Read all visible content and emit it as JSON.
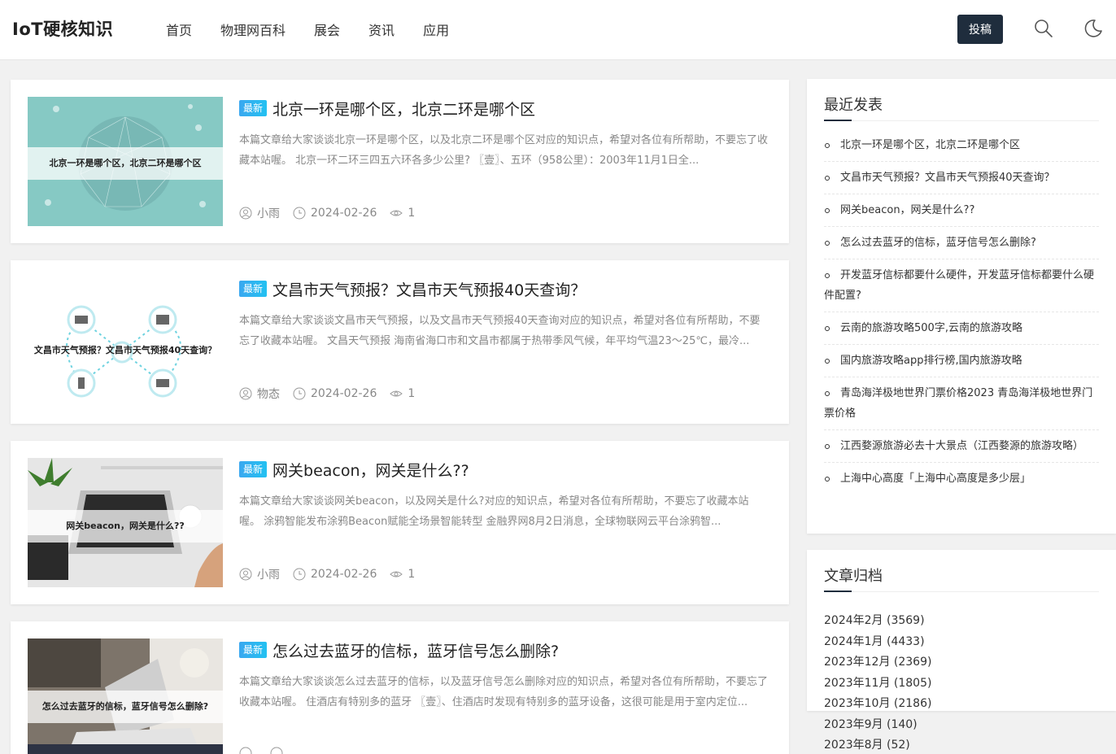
{
  "header": {
    "logo": "IoT硬核知识",
    "nav": [
      "首页",
      "物理网百科",
      "展会",
      "资讯",
      "应用"
    ],
    "post_button": "投稿",
    "icons": [
      "search-icon",
      "moon-icon"
    ]
  },
  "articles": [
    {
      "badge": "最新",
      "title": "北京一环是哪个区，北京二环是哪个区",
      "thumb_caption": "北京一环是哪个区，北京二环是哪个区",
      "excerpt": "本篇文章给大家谈谈北京一环是哪个区，以及北京二环是哪个区对应的知识点，希望对各位有所帮助，不要忘了收藏本站喔。 北京一环二环三四五六环各多少公里? 〖壹〗、五环（958公里）：2003年11月1日全...",
      "author": "小雨",
      "date": "2024-02-26",
      "views": "1"
    },
    {
      "badge": "最新",
      "title": "文昌市天气预报？文昌市天气预报40天查询？",
      "thumb_caption": "文昌市天气预报？文昌市天气预报40天查询？",
      "excerpt": "本篇文章给大家谈谈文昌市天气预报，以及文昌市天气预报40天查询对应的知识点，希望对各位有所帮助，不要忘了收藏本站喔。 文昌天气预报 海南省海口市和文昌市都属于热带季风气候，年平均气温23～25℃，最冷...",
      "author": "物态",
      "date": "2024-02-26",
      "views": "1"
    },
    {
      "badge": "最新",
      "title": "网关beacon，网关是什么??",
      "thumb_caption": "网关beacon，网关是什么??",
      "excerpt": "本篇文章给大家谈谈网关beacon，以及网关是什么?对应的知识点，希望对各位有所帮助，不要忘了收藏本站喔。 涂鸦智能发布涂鸦Beacon赋能全场景智能转型 金融界网8月2日消息，全球物联网云平台涂鸦智...",
      "author": "小雨",
      "date": "2024-02-26",
      "views": "1"
    },
    {
      "badge": "最新",
      "title": "怎么过去蓝牙的信标，蓝牙信号怎么删除?",
      "thumb_caption": "怎么过去蓝牙的信标，蓝牙信号怎么删除?",
      "excerpt": "本篇文章给大家谈谈怎么过去蓝牙的信标，以及蓝牙信号怎么删除对应的知识点，希望对各位有所帮助，不要忘了收藏本站喔。 住酒店有特别多的蓝牙 〖壹〗、住酒店时发现有特别多的蓝牙设备，这很可能是用于室内定位...",
      "author": "",
      "date": "",
      "views": ""
    }
  ],
  "sidebar": {
    "recent": {
      "title": "最近发表",
      "items": [
        "北京一环是哪个区，北京二环是哪个区",
        "文昌市天气预报？文昌市天气预报40天查询？",
        "网关beacon，网关是什么??",
        "怎么过去蓝牙的信标，蓝牙信号怎么删除?",
        "开发蓝牙信标都要什么硬件，开发蓝牙信标都要什么硬件配置?",
        "云南的旅游攻略500字,云南的旅游攻略",
        "国内旅游攻略app排行榜,国内旅游攻略",
        "青岛海洋极地世界门票价格2023 青岛海洋极地世界门票价格",
        "江西婺源旅游必去十大景点（江西婺源的旅游攻略）",
        "上海中心高度「上海中心高度是多少层」"
      ]
    },
    "archive": {
      "title": "文章归档",
      "items": [
        "2024年2月 (3569)",
        "2024年1月 (4433)",
        "2023年12月 (2369)",
        "2023年11月 (1805)",
        "2023年10月 (2186)",
        "2023年9月 (140)",
        "2023年8月 (52)"
      ]
    }
  }
}
